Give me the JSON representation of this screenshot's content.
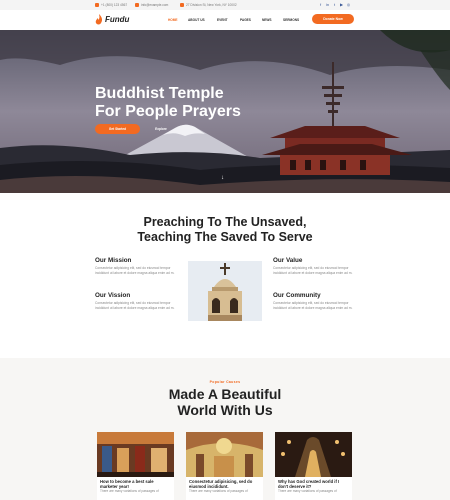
{
  "topbar": {
    "phone": "+1 (800) 123 4567",
    "email": "info@example.com",
    "address": "27 Division St, New York, NY 10002",
    "social_icons": [
      "facebook-icon",
      "linkedin-icon",
      "twitter-icon",
      "youtube-icon",
      "instagram-icon"
    ]
  },
  "nav": {
    "logo": "Fundu",
    "items": [
      "Home",
      "About Us",
      "Event",
      "Pages",
      "News",
      "Sermons"
    ],
    "donate": "Donate Now"
  },
  "hero": {
    "title_line1": "Buddhist Temple",
    "title_line2": "For People Prayers",
    "btn_primary": "Get Started",
    "btn_secondary": "Explore",
    "scroll_arrow": "↓"
  },
  "about": {
    "title_line1": "Preaching To The Unsaved,",
    "title_line2": "Teaching The Saved To Serve",
    "cards": [
      {
        "title": "Our Mission",
        "body": "Consectetur adipisicing elit, sed do eiusmod tempor incididunt ut labore et dolore magna aliqua enim ad m."
      },
      {
        "title": "Our Vission",
        "body": "Consectetur adipisicing elit, sed do eiusmod tempor incididunt ut labore et dolore magna aliqua enim ad m."
      },
      {
        "title": "Our Value",
        "body": "Consectetur adipisicing elit, sed do eiusmod tempor incididunt ut labore et dolore magna aliqua enim ad m."
      },
      {
        "title": "Our Community",
        "body": "Consectetur adipisicing elit, sed do eiusmod tempor incididunt ut labore et dolore magna aliqua enim ad m."
      }
    ]
  },
  "causes": {
    "eyebrow": "Popular Causes",
    "title_line1": "Made A Beautiful",
    "title_line2": "World With Us",
    "items": [
      {
        "title": "How to become a best sale marketer year!",
        "body": "There are many variations of passages of"
      },
      {
        "title": "Consectetur adipisicing, sed do eiusmod incididunt.",
        "body": "There are many variations of passages of"
      },
      {
        "title": "Why has God created world if I don't deserve it?",
        "body": "There are many variations of passages of"
      }
    ]
  },
  "colors": {
    "accent": "#f26a21",
    "dark": "#222222",
    "muted": "#888888"
  }
}
